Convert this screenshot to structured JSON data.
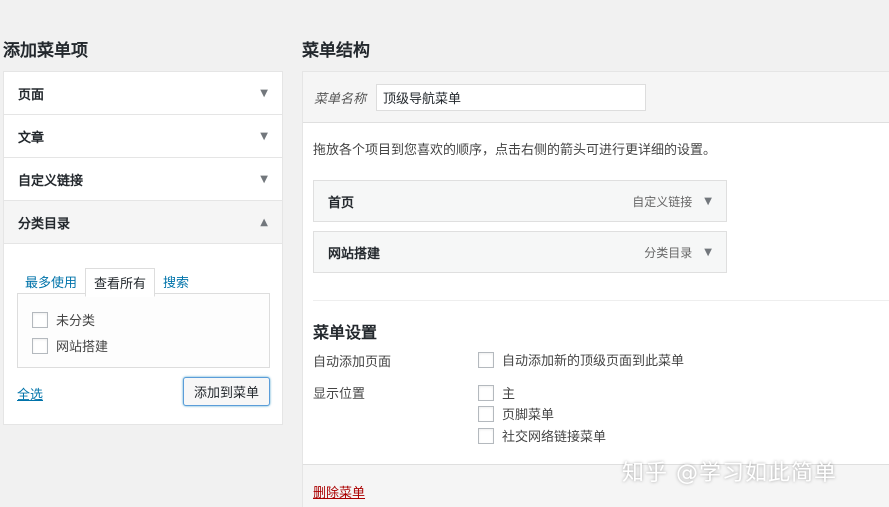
{
  "left": {
    "title": "添加菜单项",
    "accordion": [
      {
        "label": "页面",
        "state": "collapsed"
      },
      {
        "label": "文章",
        "state": "collapsed"
      },
      {
        "label": "自定义链接",
        "state": "collapsed"
      },
      {
        "label": "分类目录",
        "state": "expanded"
      }
    ],
    "tabs": [
      "最多使用",
      "查看所有",
      "搜索"
    ],
    "active_tab": "查看所有",
    "categories": [
      {
        "label": "未分类",
        "checked": false
      },
      {
        "label": "网站搭建",
        "checked": false
      }
    ],
    "select_all": "全选",
    "add_button": "添加到菜单"
  },
  "right": {
    "title": "菜单结构",
    "menu_name_label": "菜单名称",
    "menu_name_value": "顶级导航菜单",
    "instructions": "拖放各个项目到您喜欢的顺序，点击右侧的箭头可进行更详细的设置。",
    "items": [
      {
        "title": "首页",
        "type": "自定义链接"
      },
      {
        "title": "网站搭建",
        "type": "分类目录"
      }
    ],
    "settings": {
      "title": "菜单设置",
      "auto_add_label": "自动添加页面",
      "auto_add_option": "自动添加新的顶级页面到此菜单",
      "display_label": "显示位置",
      "locations": [
        "主",
        "页脚菜单",
        "社交网络链接菜单"
      ]
    },
    "delete_link": "删除菜单"
  },
  "watermark": "知乎 @学习如此简单",
  "colors": {
    "link": "#0073aa",
    "delete": "#a00000",
    "button_focus": "#5b9dd9"
  }
}
